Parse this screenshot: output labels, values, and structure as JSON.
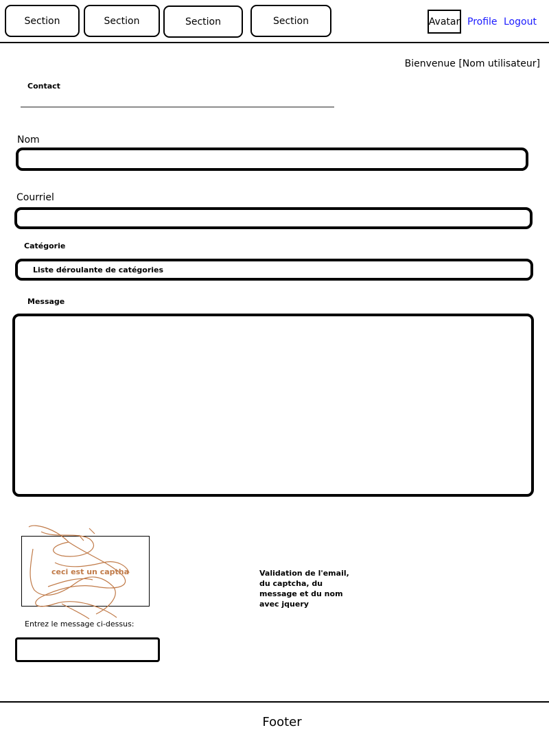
{
  "header": {
    "tabs": [
      {
        "label": "Section"
      },
      {
        "label": "Section"
      },
      {
        "label": "Section"
      },
      {
        "label": "Section"
      }
    ],
    "avatar_label": "Avatar",
    "profile_label": "Profile",
    "logout_label": "Logout",
    "link_color": "#1a1aff"
  },
  "welcome_text": "Bienvenue [Nom utilisateur]",
  "form": {
    "title": "Contact",
    "nom_label": "Nom",
    "nom_value": "",
    "courriel_label": "Courriel",
    "courriel_value": "",
    "categorie_label": "Catégorie",
    "categorie_selected": "Liste déroulante de catégories",
    "message_label": "Message",
    "message_value": ""
  },
  "captcha": {
    "image_text": "ceci est un captha",
    "prompt": "Entrez le message ci-dessus:",
    "input_value": "",
    "scribble_color": "#c07a48"
  },
  "validation_note": "Validation de l'email, du captcha, du message et du nom avec jquery",
  "footer": {
    "text": "Footer"
  }
}
